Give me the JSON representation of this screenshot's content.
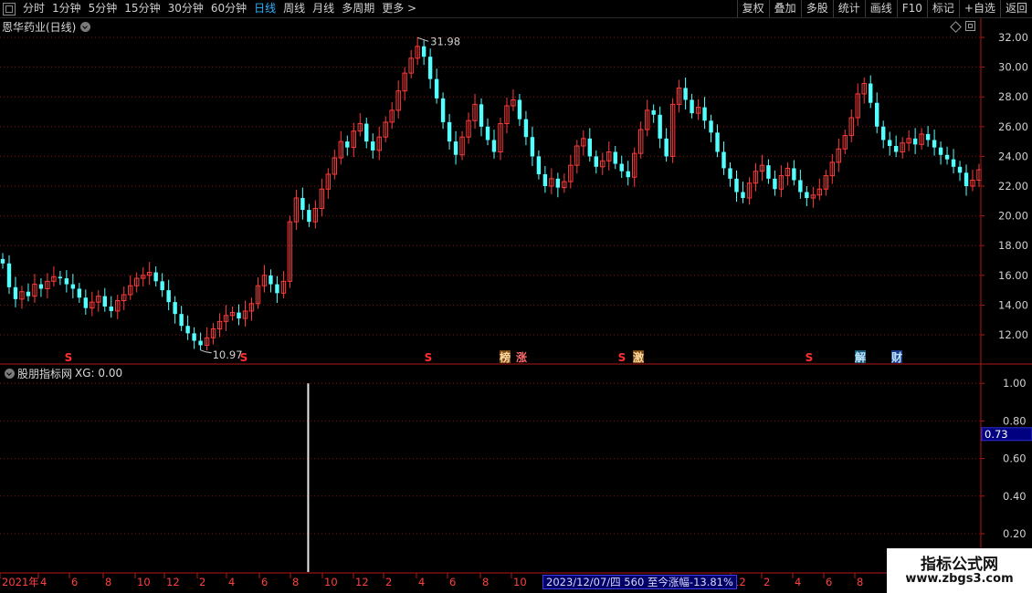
{
  "toolbar": {
    "periods": [
      "分时",
      "1分钟",
      "5分钟",
      "15分钟",
      "30分钟",
      "60分钟",
      "日线",
      "周线",
      "月线",
      "多周期",
      "更多 >"
    ],
    "active": "日线",
    "right": [
      "复权",
      "叠加",
      "多股",
      "统计",
      "画线",
      "F10",
      "标记",
      "+自选",
      "返回"
    ]
  },
  "chart_title": "恩华药业(日线)",
  "price_axis": [
    "32.00",
    "30.00",
    "28.00",
    "26.00",
    "24.00",
    "22.00",
    "20.00",
    "18.00",
    "16.00",
    "14.00",
    "12.00"
  ],
  "high_label": "31.98",
  "low_label": "10.97",
  "events": [
    {
      "text": "S",
      "color": "#ff3030"
    },
    {
      "text": "S",
      "color": "#ff3030"
    },
    {
      "text": "S",
      "color": "#ff3030"
    },
    {
      "text": "榜",
      "color": "#ffd8a0",
      "bg": "#7a4a10"
    },
    {
      "text": "涨",
      "color": "#ff6a6a"
    },
    {
      "text": "S",
      "color": "#ff3030"
    },
    {
      "text": "激",
      "color": "#ffd8a0",
      "bg": "#7a4a10"
    },
    {
      "text": "S",
      "color": "#ff3030"
    },
    {
      "text": "解",
      "color": "#bfe6ff",
      "bg": "#1a5a7a"
    },
    {
      "text": "财",
      "color": "#bfe6ff",
      "bg": "#1a3a8a"
    }
  ],
  "indicator": {
    "name": "股朋指标网",
    "value": "XG: 0.00",
    "axis": [
      "1.00",
      "0.80",
      "0.60",
      "0.40",
      "0.20"
    ],
    "cursor_value": "0.73"
  },
  "date_axis": [
    "2021年",
    "4",
    "6",
    "8",
    "10",
    "12",
    "2",
    "4",
    "6",
    "8",
    "10",
    "12",
    "2",
    "4",
    "6",
    "8",
    "10",
    "12",
    "2",
    "4",
    "6",
    "8"
  ],
  "status_text": "2023/12/07/四 560 至今涨幅-13.81%",
  "watermark": {
    "line1": "指标公式网",
    "line2": "www.zbgs3.com"
  },
  "colors": {
    "up": "#ff3b3b",
    "down": "#54ffff",
    "grid": "#8a1010",
    "axis_line": "#b01818",
    "active_tab": "#2fb2ff"
  },
  "chart_data": {
    "type": "candlestick",
    "title": "恩华药业(日线)",
    "ylim": [
      10.97,
      31.98
    ],
    "y_ticks": [
      12,
      14,
      16,
      18,
      20,
      22,
      24,
      26,
      28,
      30,
      32
    ],
    "marked_high": 31.98,
    "marked_low": 10.97,
    "closes": [
      16.8,
      15.2,
      14.4,
      14.9,
      14.6,
      15.4,
      15.1,
      15.6,
      15.9,
      15.8,
      15.4,
      15.1,
      14.5,
      13.8,
      14.2,
      14.6,
      13.9,
      13.6,
      14.3,
      14.7,
      15.3,
      15.8,
      16.0,
      16.2,
      15.6,
      15.0,
      14.2,
      13.4,
      12.6,
      12.1,
      11.6,
      11.3,
      11.8,
      12.4,
      12.9,
      13.3,
      13.5,
      13.1,
      13.6,
      14.1,
      15.3,
      16.0,
      15.4,
      14.8,
      15.6,
      19.6,
      21.2,
      20.4,
      19.6,
      20.5,
      21.8,
      22.8,
      23.9,
      25.0,
      24.6,
      25.7,
      26.2,
      25.0,
      24.4,
      25.3,
      26.3,
      27.1,
      28.4,
      29.6,
      30.6,
      31.4,
      30.7,
      29.2,
      27.9,
      26.3,
      25.0,
      24.1,
      25.3,
      26.4,
      27.5,
      26.0,
      25.1,
      24.3,
      26.2,
      27.4,
      27.8,
      26.5,
      25.3,
      24.0,
      22.8,
      22.0,
      22.5,
      21.9,
      22.3,
      23.4,
      24.7,
      25.2,
      24.0,
      23.3,
      23.7,
      24.3,
      23.5,
      23.0,
      22.6,
      24.2,
      25.8,
      27.1,
      26.8,
      25.2,
      24.0,
      27.5,
      28.6,
      27.8,
      26.9,
      27.3,
      26.4,
      25.6,
      24.3,
      23.2,
      22.5,
      21.6,
      21.2,
      22.2,
      23.0,
      23.4,
      22.5,
      21.8,
      22.7,
      23.2,
      22.4,
      21.6,
      21.2,
      21.4,
      21.8,
      22.7,
      23.6,
      24.5,
      25.4,
      26.6,
      28.2,
      28.9,
      27.6,
      26.0,
      25.1,
      24.7,
      24.3,
      24.9,
      25.2,
      24.8,
      25.5,
      25.1,
      24.6,
      24.1,
      23.8,
      23.3,
      22.9,
      22.0,
      22.4,
      23.1
    ]
  },
  "xg_chart": {
    "type": "bar",
    "spike_position": 0.3035,
    "spike_value": 1.0,
    "cursor_level": 0.73
  }
}
